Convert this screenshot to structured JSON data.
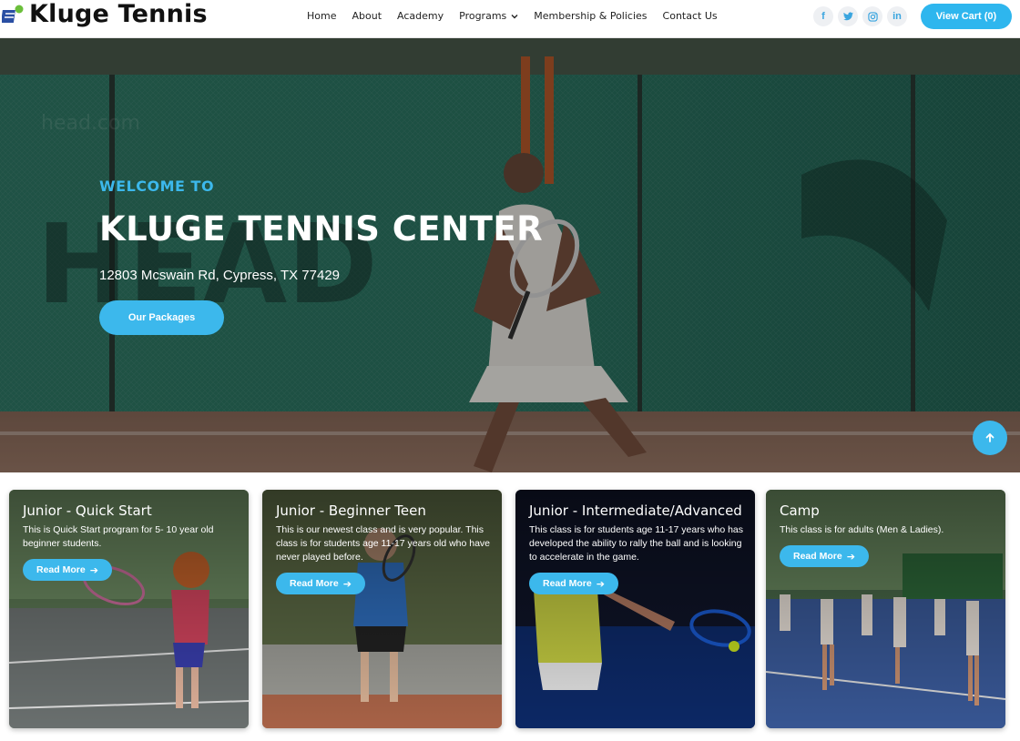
{
  "brand": {
    "name": "Kluge Tennis"
  },
  "nav": {
    "items": [
      "Home",
      "About",
      "Academy",
      "Programs",
      "Membership & Policies",
      "Contact Us"
    ]
  },
  "socials": {
    "facebook": "f",
    "twitter": "t",
    "instagram": "◎",
    "linkedin": "in"
  },
  "cart": {
    "label": "View Cart (0)"
  },
  "hero": {
    "welcome": "WELCOME TO",
    "title": "KLUGE TENNIS CENTER",
    "address": "12803 Mcswain Rd, Cypress, TX 77429",
    "button": "Our Packages"
  },
  "cards": [
    {
      "title": "Junior - Quick Start",
      "text": "This is Quick Start program for 5- 10 year old beginner students.",
      "button": "Read More"
    },
    {
      "title": "Junior - Beginner Teen",
      "text": "This is our newest class and is very popular. This class is for students age 11-17 years old who have never played before.",
      "button": "Read More"
    },
    {
      "title": "Junior - Intermediate/Advanced",
      "text": "This class is for students age 11-17 years who has developed the ability to rally the ball and is looking to accelerate in the game.",
      "button": "Read More"
    },
    {
      "title": "Camp",
      "text": "This class is for adults (Men & Ladies).",
      "button": "Read More"
    }
  ],
  "colors": {
    "accent": "#3cb8ec",
    "cart": "#2eb6ee"
  }
}
